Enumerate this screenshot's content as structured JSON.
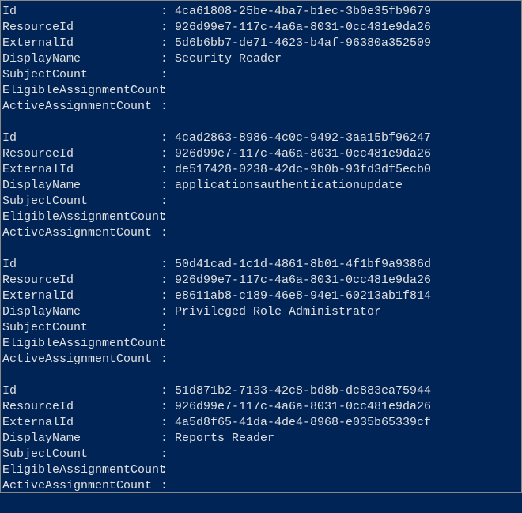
{
  "records": [
    {
      "Id": "4ca61808-25be-4ba7-b1ec-3b0e35fb9679",
      "ResourceId": "926d99e7-117c-4a6a-8031-0cc481e9da26",
      "ExternalId": "5d6b6bb7-de71-4623-b4af-96380a352509",
      "DisplayName": "Security Reader",
      "SubjectCount": "",
      "EligibleAssignmentCount": "",
      "ActiveAssignmentCount": ""
    },
    {
      "Id": "4cad2863-8986-4c0c-9492-3aa15bf96247",
      "ResourceId": "926d99e7-117c-4a6a-8031-0cc481e9da26",
      "ExternalId": "de517428-0238-42dc-9b0b-93fd3df5ecb0",
      "DisplayName": "applicationsauthenticationupdate",
      "SubjectCount": "",
      "EligibleAssignmentCount": "",
      "ActiveAssignmentCount": ""
    },
    {
      "Id": "50d41cad-1c1d-4861-8b01-4f1bf9a9386d",
      "ResourceId": "926d99e7-117c-4a6a-8031-0cc481e9da26",
      "ExternalId": "e8611ab8-c189-46e8-94e1-60213ab1f814",
      "DisplayName": "Privileged Role Administrator",
      "SubjectCount": "",
      "EligibleAssignmentCount": "",
      "ActiveAssignmentCount": ""
    },
    {
      "Id": "51d871b2-7133-42c8-bd8b-dc883ea75944",
      "ResourceId": "926d99e7-117c-4a6a-8031-0cc481e9da26",
      "ExternalId": "4a5d8f65-41da-4de4-8968-e035b65339cf",
      "DisplayName": "Reports Reader",
      "SubjectCount": "",
      "EligibleAssignmentCount": "",
      "ActiveAssignmentCount": ""
    }
  ],
  "fields": [
    "Id",
    "ResourceId",
    "ExternalId",
    "DisplayName",
    "SubjectCount",
    "EligibleAssignmentCount",
    "ActiveAssignmentCount"
  ],
  "colon": ":"
}
